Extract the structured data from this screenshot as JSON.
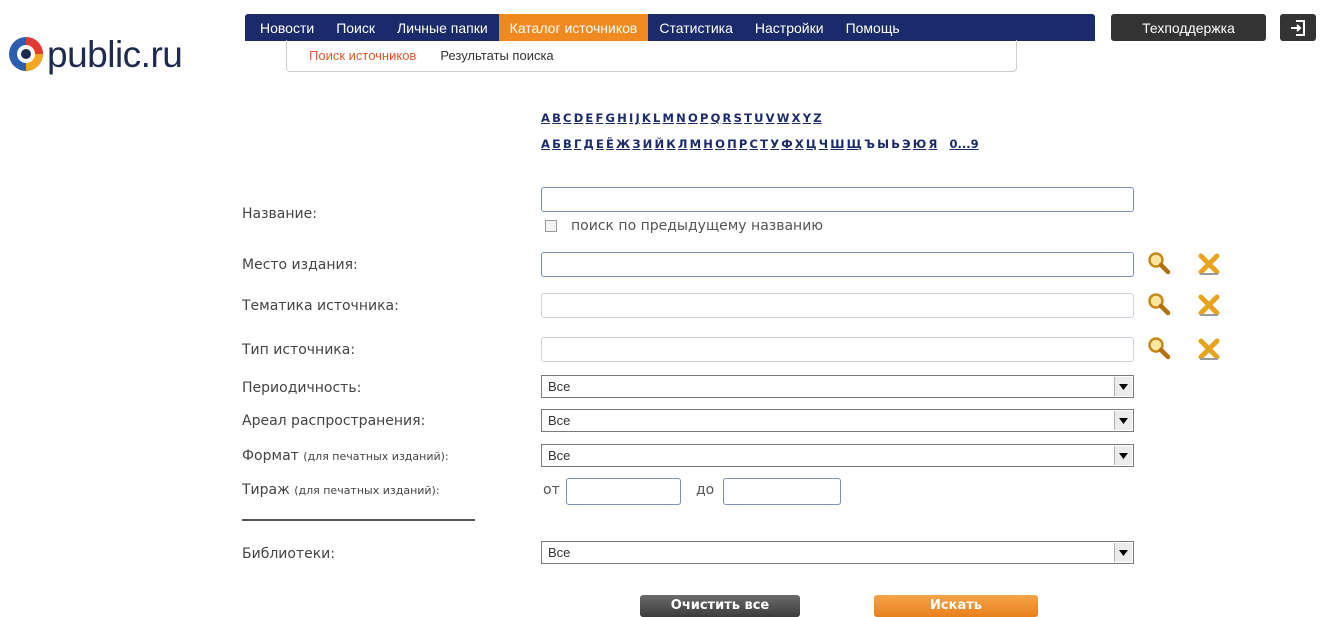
{
  "logo": {
    "text": "public.ru"
  },
  "nav": {
    "items": [
      {
        "label": "Новости",
        "active": false
      },
      {
        "label": "Поиск",
        "active": false
      },
      {
        "label": "Личные папки",
        "active": false
      },
      {
        "label": "Каталог источников",
        "active": true
      },
      {
        "label": "Статистика",
        "active": false
      },
      {
        "label": "Настройки",
        "active": false
      },
      {
        "label": "Помощь",
        "active": false
      }
    ],
    "support_label": "Техподдержка",
    "logout_icon": "logout-icon"
  },
  "subnav": {
    "items": [
      {
        "label": "Поиск источников",
        "active": true
      },
      {
        "label": "Результаты поиска",
        "active": false
      }
    ]
  },
  "alphabet": {
    "latin": [
      "A",
      "B",
      "C",
      "D",
      "E",
      "F",
      "G",
      "H",
      "I",
      "J",
      "K",
      "L",
      "M",
      "N",
      "O",
      "P",
      "Q",
      "R",
      "S",
      "T",
      "U",
      "V",
      "W",
      "X",
      "Y",
      "Z"
    ],
    "cyrillic": [
      "А",
      "Б",
      "В",
      "Г",
      "Д",
      "Е",
      "Ё",
      "Ж",
      "З",
      "И",
      "Й",
      "К",
      "Л",
      "М",
      "Н",
      "О",
      "П",
      "Р",
      "С",
      "Т",
      "У",
      "Ф",
      "Х",
      "Ц",
      "Ч",
      "Ш",
      "Щ",
      "Ъ",
      "Ы",
      "Ь",
      "Э",
      "Ю",
      "Я"
    ],
    "cyrillic_plain": [
      "Ъ",
      "Ы",
      "Ь"
    ],
    "numbers": "0...9"
  },
  "form": {
    "name_label": "Название:",
    "name_value": "",
    "prev_name_checkbox": "поиск по предыдущему названию",
    "place_label": "Место издания:",
    "theme_label": "Тематика источника:",
    "type_label": "Тип источника:",
    "periodicity_label": "Периодичность:",
    "periodicity_value": "Все",
    "area_label": "Ареал распространения:",
    "area_value": "Все",
    "format_label": "Формат",
    "format_note": "(для печатных изданий):",
    "format_value": "Все",
    "circulation_label": "Тираж",
    "circulation_note": "(для печатных изданий):",
    "from_label": "от",
    "to_label": "до",
    "libraries_label": "Библиотеки:",
    "libraries_value": "Все"
  },
  "buttons": {
    "clear_label": "Очистить все",
    "search_label": "Искать"
  },
  "colors": {
    "nav_bg": "#1b2a6b",
    "accent": "#f08a20",
    "subnav_active": "#e0562a"
  }
}
